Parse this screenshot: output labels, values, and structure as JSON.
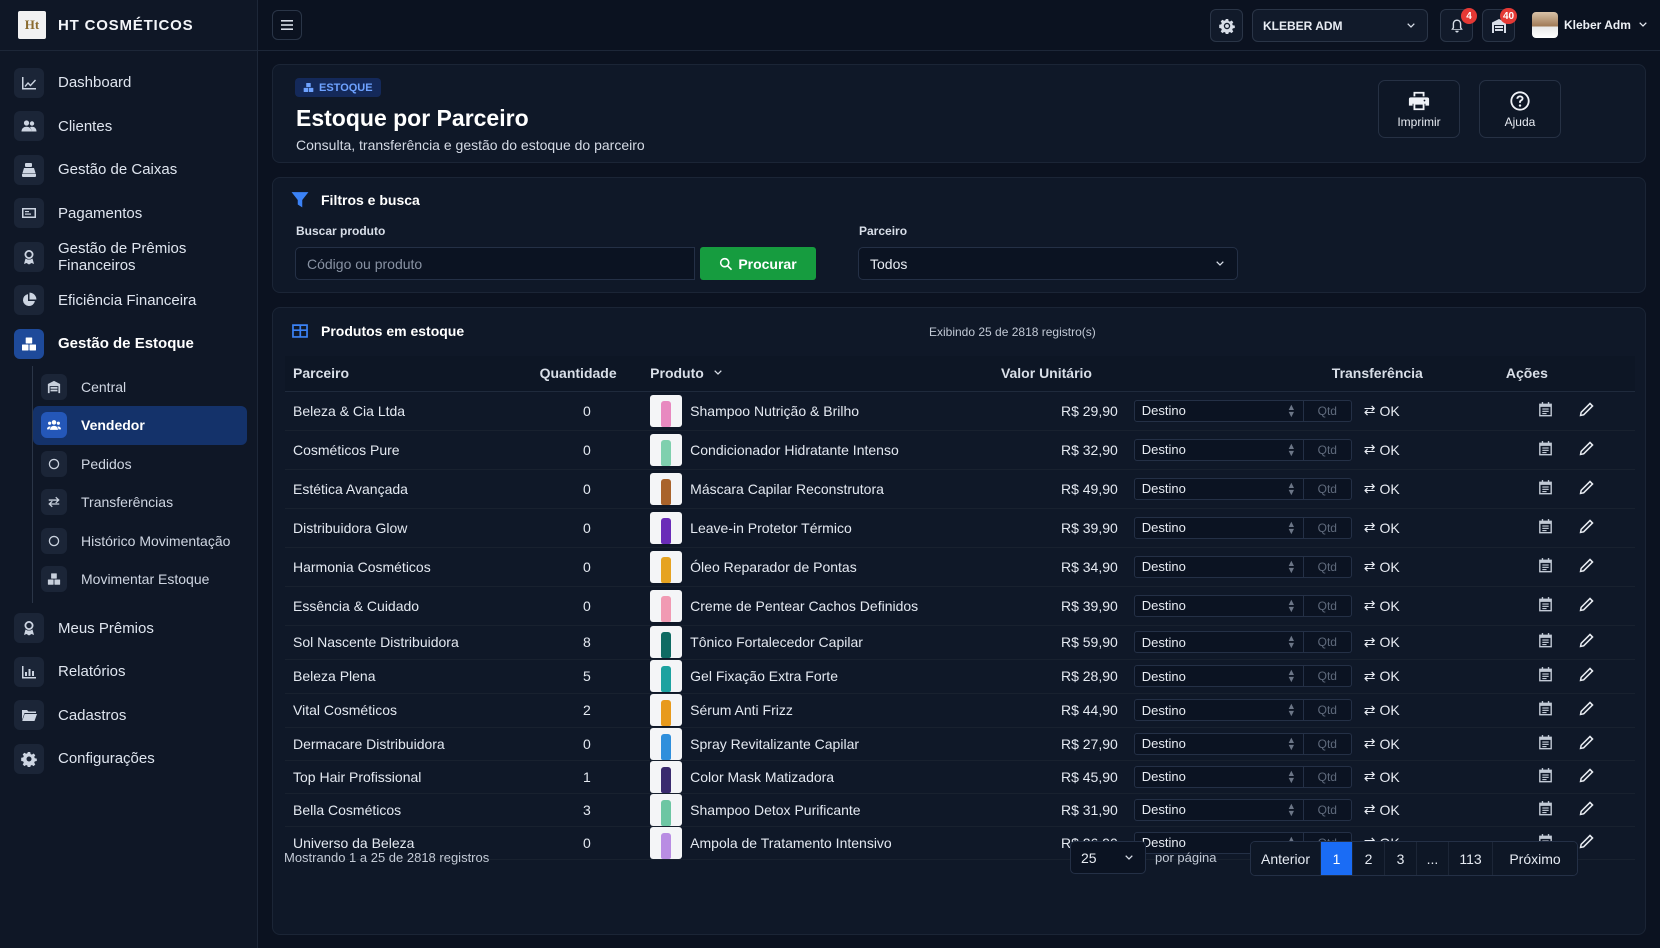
{
  "brand": {
    "logo_text": "Ht",
    "name": "HT COSMÉTICOS"
  },
  "sidebar": {
    "items": [
      {
        "label": "Dashboard",
        "icon": "chart-line-icon"
      },
      {
        "label": "Clientes",
        "icon": "users-icon"
      },
      {
        "label": "Gestão de Caixas",
        "icon": "cash-register-icon"
      },
      {
        "label": "Pagamentos",
        "icon": "money-icon"
      },
      {
        "label": "Gestão de Prêmios Financeiros",
        "icon": "award-icon"
      },
      {
        "label": "Eficiência Financeira",
        "icon": "pie-chart-icon"
      },
      {
        "label": "Gestão de Estoque",
        "icon": "boxes-icon"
      }
    ],
    "sub_items": [
      {
        "label": "Central",
        "icon": "warehouse-icon"
      },
      {
        "label": "Vendedor",
        "icon": "users-icon"
      },
      {
        "label": "Pedidos",
        "icon": "circle-icon"
      },
      {
        "label": "Transferências",
        "icon": "exchange-icon"
      },
      {
        "label": "Histórico Movimentação",
        "icon": "circle-icon"
      },
      {
        "label": "Movimentar Estoque",
        "icon": "boxes-icon"
      }
    ],
    "bottom_items": [
      {
        "label": "Meus Prêmios",
        "icon": "award-icon"
      },
      {
        "label": "Relatórios",
        "icon": "bar-chart-icon"
      },
      {
        "label": "Cadastros",
        "icon": "folder-icon"
      },
      {
        "label": "Configurações",
        "icon": "gear-icon"
      }
    ]
  },
  "topbar": {
    "account_select": "KLEBER ADM",
    "notifications_count": "4",
    "stock_alerts_count": "40",
    "user_name": "Kleber Adm"
  },
  "header": {
    "tag": "ESTOQUE",
    "title": "Estoque por Parceiro",
    "subtitle": "Consulta, transferência e gestão do estoque do parceiro",
    "print_label": "Imprimir",
    "help_label": "Ajuda"
  },
  "filters": {
    "title": "Filtros e busca",
    "search_label": "Buscar produto",
    "search_placeholder": "Código ou produto",
    "search_button": "Procurar",
    "partner_label": "Parceiro",
    "partner_value": "Todos"
  },
  "table": {
    "title": "Produtos em estoque",
    "count_text": "Exibindo 25 de 2818 registro(s)",
    "columns": {
      "partner": "Parceiro",
      "quantity": "Quantidade",
      "product": "Produto",
      "unit_value": "Valor Unitário",
      "transfer": "Transferência",
      "actions": "Ações"
    },
    "dest_label": "Destino",
    "qtd_placeholder": "Qtd",
    "ok_label": "OK",
    "rows": [
      {
        "partner": "Beleza & Cia Ltda",
        "qty": "0",
        "product": "Shampoo Nutrição & Brilho",
        "price": "R$ 29,90",
        "bottle_color": "#e889c0"
      },
      {
        "partner": "Cosméticos Pure",
        "qty": "0",
        "product": "Condicionador Hidratante Intenso",
        "price": "R$ 32,90",
        "bottle_color": "#7fd0ae"
      },
      {
        "partner": "Estética Avançada",
        "qty": "0",
        "product": "Máscara Capilar Reconstrutora",
        "price": "R$ 49,90",
        "bottle_color": "#a9632b"
      },
      {
        "partner": "Distribuidora Glow",
        "qty": "0",
        "product": "Leave-in Protetor Térmico",
        "price": "R$ 39,90",
        "bottle_color": "#6a2cb8"
      },
      {
        "partner": "Harmonia Cosméticos",
        "qty": "0",
        "product": "Óleo Reparador de Pontas",
        "price": "R$ 34,90",
        "bottle_color": "#e6a321"
      },
      {
        "partner": "Essência & Cuidado",
        "qty": "0",
        "product": "Creme de Pentear Cachos Definidos",
        "price": "R$ 39,90",
        "bottle_color": "#f19ab3"
      },
      {
        "partner": "Sol Nascente Distribuidora",
        "qty": "8",
        "product": "Tônico Fortalecedor Capilar",
        "price": "R$ 59,90",
        "bottle_color": "#0f6b63"
      },
      {
        "partner": "Beleza Plena",
        "qty": "5",
        "product": "Gel Fixação Extra Forte",
        "price": "R$ 28,90",
        "bottle_color": "#1da2a0"
      },
      {
        "partner": "Vital Cosméticos",
        "qty": "2",
        "product": "Sérum Anti Frizz",
        "price": "R$ 44,90",
        "bottle_color": "#e89a1c"
      },
      {
        "partner": "Dermacare Distribuidora",
        "qty": "0",
        "product": "Spray Revitalizante Capilar",
        "price": "R$ 27,90",
        "bottle_color": "#2f8fdc"
      },
      {
        "partner": "Top Hair Profissional",
        "qty": "1",
        "product": "Color Mask Matizadora",
        "price": "R$ 45,90",
        "bottle_color": "#3a2a6e"
      },
      {
        "partner": "Bella Cosméticos",
        "qty": "3",
        "product": "Shampoo Detox Purificante",
        "price": "R$ 31,90",
        "bottle_color": "#6dc6a3"
      },
      {
        "partner": "Universo da Beleza",
        "qty": "0",
        "product": "Ampola de Tratamento Intensivo",
        "price": "R$ 26,90",
        "bottle_color": "#b98de3"
      }
    ]
  },
  "footer": {
    "showing_text": "Mostrando 1 a 25 de 2818 registros",
    "per_page_value": "25",
    "per_page_label": "por página",
    "pages": [
      "Anterior",
      "1",
      "2",
      "3",
      "...",
      "113",
      "Próximo"
    ],
    "active_page": "1"
  },
  "colors": {
    "accent": "#1a6cf5",
    "success": "#169c3f",
    "badge": "#e53935"
  }
}
